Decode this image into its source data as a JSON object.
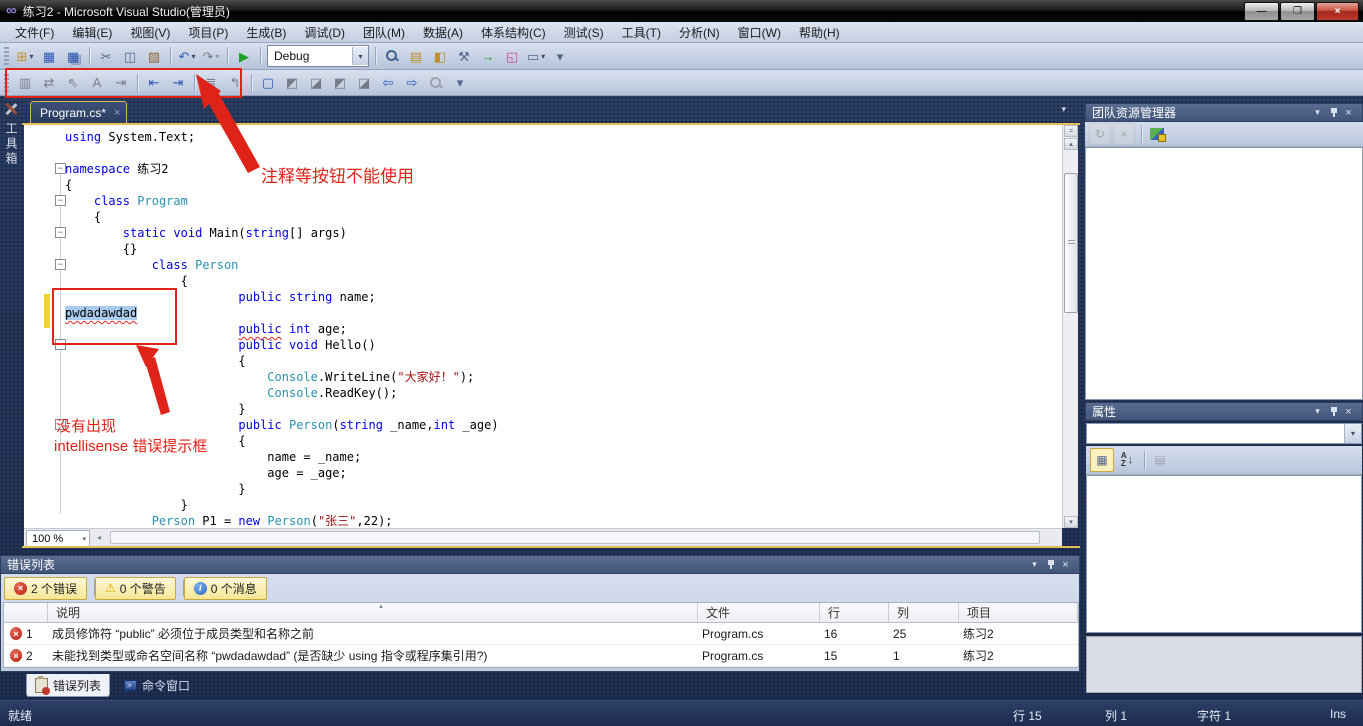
{
  "window": {
    "title": "练习2 - Microsoft Visual Studio(管理员)"
  },
  "icons": {
    "vs_logo": "∞",
    "minimize": "—",
    "restore": "❐",
    "close": "×",
    "dropdown": "▾",
    "doc_dropdown": "▾",
    "tab_close": "×",
    "sort_asc": "▲",
    "error": "×",
    "warning": "⚠",
    "info": "i",
    "scroll_up": "▴",
    "scroll_down": "▾",
    "scroll_left": "◂",
    "refresh": "↻",
    "cancel": "×",
    "categorized": "▦",
    "az_stack": "A\nZ",
    "az_down": "↓",
    "prop_pages": "▤",
    "prompt": ">"
  },
  "menu": {
    "items": [
      "文件(F)",
      "编辑(E)",
      "视图(V)",
      "项目(P)",
      "生成(B)",
      "调试(D)",
      "团队(M)",
      "数据(A)",
      "体系结构(C)",
      "测试(S)",
      "工具(T)",
      "分析(N)",
      "窗口(W)",
      "帮助(H)"
    ]
  },
  "toolbar_main": {
    "debug_value": "Debug",
    "items": [
      {
        "n": "new-project-button",
        "g": "⊞",
        "cls": "amberI",
        "dd": true
      },
      {
        "n": "save-button",
        "g": "▦",
        "cls": "blueI"
      },
      {
        "n": "save-all-button",
        "g": "▦",
        "cls": "blueI sh"
      },
      {
        "sep": true
      },
      {
        "n": "cut-button",
        "g": "✂",
        "cls": "steelI"
      },
      {
        "n": "copy-button",
        "g": "◫",
        "cls": "steelI"
      },
      {
        "n": "paste-button",
        "g": "▨",
        "cls": "brownI"
      },
      {
        "sep": true
      },
      {
        "n": "undo-button",
        "g": "↶",
        "cls": "blueI",
        "dd": true
      },
      {
        "n": "redo-button",
        "g": "↷",
        "dis": true,
        "dd": true
      },
      {
        "sep": true
      },
      {
        "n": "start-debug-button",
        "g": "▶",
        "cls": "greenI"
      },
      {
        "sep": true
      },
      {
        "combo": true
      },
      {
        "sep": true
      },
      {
        "n": "find-in-files-button",
        "mag": true
      },
      {
        "n": "properties-window-button",
        "g": "▤",
        "cls": "amberI"
      },
      {
        "n": "solution-explorer-button",
        "g": "◧",
        "cls": "amberI"
      },
      {
        "n": "toolbox-button",
        "g": "⚒",
        "cls": "steelI"
      },
      {
        "n": "start-page-button",
        "g": "→",
        "cls": "greenI"
      },
      {
        "n": "object-browser-button",
        "g": "◱",
        "cls": "pinkI"
      },
      {
        "n": "command-window-button",
        "g": "▭",
        "cls": "steelI",
        "dd": true
      },
      {
        "n": "toolbar-options-button",
        "g": "▾",
        "cls": "steelI"
      }
    ]
  },
  "toolbar_edit": {
    "items": [
      {
        "n": "display-designer-button",
        "g": "▥",
        "dis": true
      },
      {
        "n": "sync-view-button",
        "g": "⇄",
        "dis": true
      },
      {
        "n": "pointer-button",
        "g": "⇖",
        "dis": true
      },
      {
        "n": "font-button",
        "g": "A",
        "dis": true
      },
      {
        "n": "indent-guides-button",
        "g": "⇥",
        "dis": true
      },
      {
        "sep": true
      },
      {
        "n": "decrease-indent-button",
        "g": "⇤",
        "cls": "blueI"
      },
      {
        "n": "increase-indent-button",
        "g": "⇥",
        "cls": "blueI"
      },
      {
        "sep": true
      },
      {
        "n": "comment-button",
        "g": "≣",
        "dis": true
      },
      {
        "n": "uncomment-button",
        "g": "↰",
        "dis": true
      },
      {
        "sep": true
      },
      {
        "n": "toggle-bookmark-button",
        "g": "▢",
        "cls": "blueI"
      },
      {
        "n": "prev-bookmark-button",
        "g": "◩",
        "dis": true
      },
      {
        "n": "next-bookmark-button",
        "g": "◪",
        "dis": true
      },
      {
        "n": "prev-bookmark-folder-button",
        "g": "◩",
        "dis": true
      },
      {
        "n": "next-bookmark-folder-button",
        "g": "◪",
        "dis": true
      },
      {
        "n": "prev-bookmark-doc-button",
        "g": "⇦",
        "cls": "blueI"
      },
      {
        "n": "next-bookmark-doc-button",
        "g": "⇨",
        "cls": "blueI"
      },
      {
        "n": "clear-bookmarks-button",
        "mag": true,
        "dis": true
      },
      {
        "n": "toolbar-options2-button",
        "g": "▾",
        "cls": "steelI"
      }
    ]
  },
  "toolbox_tab": {
    "label": "工具箱"
  },
  "editor": {
    "tab_label": "Program.cs*",
    "zoom_value": "100 %",
    "fold_lines": [
      2,
      4,
      6,
      8,
      13,
      18
    ],
    "lines": [
      [
        [
          "k",
          "using"
        ],
        [
          "n",
          " System.Text;"
        ]
      ],
      [
        [
          "n",
          ""
        ]
      ],
      [
        [
          "k",
          "namespace"
        ],
        [
          "n",
          " 练习2"
        ]
      ],
      [
        [
          "n",
          "{"
        ]
      ],
      [
        [
          "n",
          "    "
        ],
        [
          "k",
          "class"
        ],
        [
          "n",
          " "
        ],
        [
          "t",
          "Program"
        ]
      ],
      [
        [
          "n",
          "    {"
        ]
      ],
      [
        [
          "n",
          "        "
        ],
        [
          "k",
          "static"
        ],
        [
          "n",
          " "
        ],
        [
          "k",
          "void"
        ],
        [
          "n",
          " Main("
        ],
        [
          "k",
          "string"
        ],
        [
          "n",
          "[] args)"
        ]
      ],
      [
        [
          "n",
          "        {}"
        ]
      ],
      [
        [
          "n",
          "            "
        ],
        [
          "k",
          "class"
        ],
        [
          "n",
          " "
        ],
        [
          "t",
          "Person"
        ]
      ],
      [
        [
          "n",
          "                {"
        ]
      ],
      [
        [
          "n",
          "                        "
        ],
        [
          "k",
          "public"
        ],
        [
          "n",
          " "
        ],
        [
          "k",
          "string"
        ],
        [
          "n",
          " name;"
        ]
      ],
      [
        [
          "sel",
          "pwdadawdad"
        ]
      ],
      [
        [
          "n",
          "                        "
        ],
        [
          "ke",
          "public"
        ],
        [
          "n",
          " "
        ],
        [
          "k",
          "int"
        ],
        [
          "n",
          " age;"
        ]
      ],
      [
        [
          "n",
          "                        "
        ],
        [
          "k",
          "public"
        ],
        [
          "n",
          " "
        ],
        [
          "k",
          "void"
        ],
        [
          "n",
          " Hello()"
        ]
      ],
      [
        [
          "n",
          "                        {"
        ]
      ],
      [
        [
          "n",
          "                            "
        ],
        [
          "t",
          "Console"
        ],
        [
          "n",
          ".WriteLine("
        ],
        [
          "s",
          "\"大家好！\""
        ],
        [
          "n",
          ");"
        ]
      ],
      [
        [
          "n",
          "                            "
        ],
        [
          "t",
          "Console"
        ],
        [
          "n",
          ".ReadKey();"
        ]
      ],
      [
        [
          "n",
          "                        }"
        ]
      ],
      [
        [
          "n",
          "                        "
        ],
        [
          "k",
          "public"
        ],
        [
          "n",
          " "
        ],
        [
          "t",
          "Person"
        ],
        [
          "n",
          "("
        ],
        [
          "k",
          "string"
        ],
        [
          "n",
          " _name,"
        ],
        [
          "k",
          "int"
        ],
        [
          "n",
          " _age)"
        ]
      ],
      [
        [
          "n",
          "                        {"
        ]
      ],
      [
        [
          "n",
          "                            name = _name;"
        ]
      ],
      [
        [
          "n",
          "                            age = _age;"
        ]
      ],
      [
        [
          "n",
          "                        }"
        ]
      ],
      [
        [
          "n",
          "                }"
        ]
      ],
      [
        [
          "n",
          "            "
        ],
        [
          "t",
          "Person"
        ],
        [
          "n",
          " P1 = "
        ],
        [
          "k",
          "new"
        ],
        [
          "n",
          " "
        ],
        [
          "t",
          "Person"
        ],
        [
          "n",
          "("
        ],
        [
          "s",
          "\"张三\""
        ],
        [
          "n",
          ",22);"
        ]
      ]
    ]
  },
  "annotations": {
    "note1": "注释等按钮不能使用",
    "note2_line1": "没有出现",
    "note2_line2": "intellisense 错误提示框"
  },
  "team_explorer": {
    "title": "团队资源管理器"
  },
  "properties": {
    "title": "属性"
  },
  "error_list": {
    "title": "错误列表",
    "buttons": {
      "errors": "2 个错误",
      "warnings": "0 个警告",
      "messages": "0 个消息"
    },
    "columns": [
      "说明",
      "文件",
      "行",
      "列",
      "项目"
    ],
    "rows": [
      {
        "num": "1",
        "desc": "成员修饰符 “public” 必须位于成员类型和名称之前",
        "file": "Program.cs",
        "line": "16",
        "col": "25",
        "project": "练习2"
      },
      {
        "num": "2",
        "desc": "未能找到类型或命名空间名称 “pwdadawdad” (是否缺少 using 指令或程序集引用?)",
        "file": "Program.cs",
        "line": "15",
        "col": "1",
        "project": "练习2"
      }
    ]
  },
  "bottom_tabs": {
    "error_list": "错误列表",
    "command_window": "命令窗口"
  },
  "status": {
    "ready": "就绪",
    "line": "行 15",
    "col": "列 1",
    "char": "字符 1",
    "ins": "Ins"
  }
}
